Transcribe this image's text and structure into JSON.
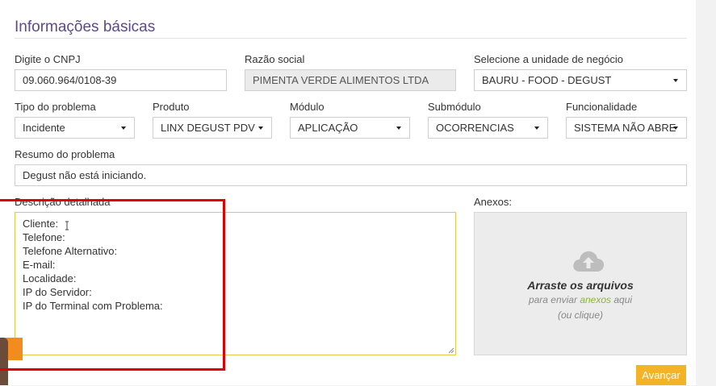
{
  "section": {
    "title": "Informações básicas"
  },
  "row1": {
    "cnpj": {
      "label": "Digite o CNPJ",
      "value": "09.060.964/0108-39"
    },
    "razao": {
      "label": "Razão social",
      "value": "PIMENTA VERDE ALIMENTOS LTDA"
    },
    "unidade": {
      "label": "Selecione a unidade de negócio",
      "value": "BAURU - FOOD - DEGUST"
    }
  },
  "row2": {
    "tipo": {
      "label": "Tipo do problema",
      "value": "Incidente"
    },
    "produto": {
      "label": "Produto",
      "value": "LINX DEGUST PDV"
    },
    "modulo": {
      "label": "Módulo",
      "value": "APLICAÇÃO"
    },
    "submodulo": {
      "label": "Submódulo",
      "value": "OCORRENCIAS"
    },
    "funcionalidade": {
      "label": "Funcionalidade",
      "value": "SISTEMA NÃO ABRE"
    }
  },
  "resumo": {
    "label": "Resumo do problema",
    "value": "Degust não está iniciando."
  },
  "descricao": {
    "label": "Descrição detalhada",
    "lines": [
      "Cliente:",
      "Telefone:",
      "Telefone Alternativo:",
      "E-mail:",
      "Localidade:",
      "IP do Servidor:",
      "IP do Terminal com Problema:"
    ]
  },
  "anexos": {
    "label": "Anexos:",
    "title": "Arraste os arquivos",
    "sub_before": "para enviar ",
    "sub_link": "anexos",
    "sub_after": " aqui",
    "click_hint": "(ou clique)",
    "icon": "cloud-upload-icon"
  },
  "actions": {
    "next_label": "Avançar"
  },
  "colors": {
    "title": "#5a4a8a",
    "accent": "#f4b226",
    "highlight": "#e00000",
    "link_green": "#8bb33a"
  }
}
